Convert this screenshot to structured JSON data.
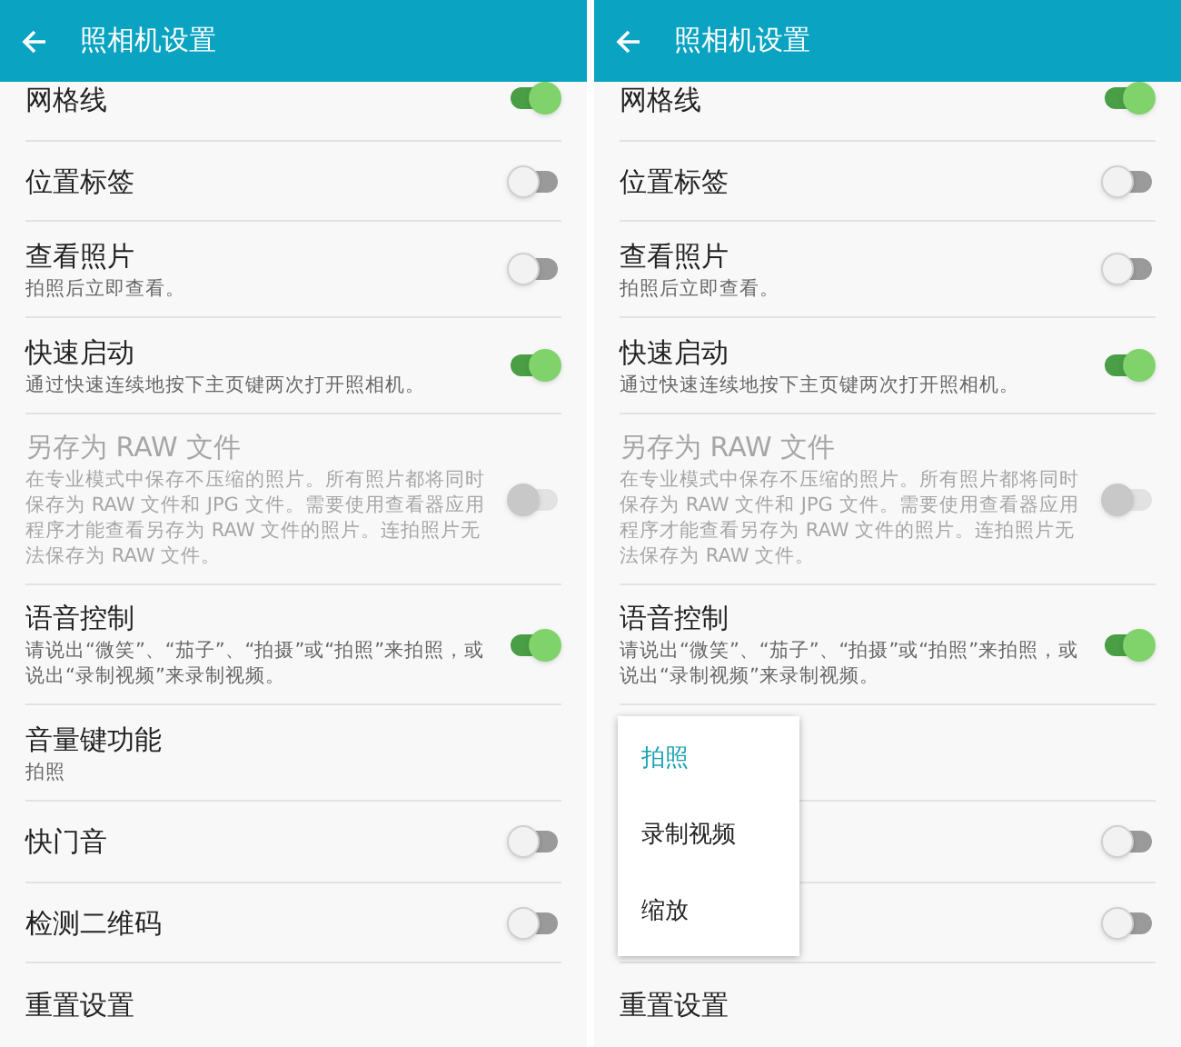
{
  "panels": [
    {
      "header": {
        "title": "照相机设置"
      },
      "settings": [
        {
          "kind": "toggle",
          "title": "网格线",
          "on": true,
          "disabled": false
        },
        {
          "kind": "toggle",
          "title": "位置标签",
          "on": false,
          "disabled": false
        },
        {
          "kind": "toggle",
          "title": "查看照片",
          "subtitle": "拍照后立即查看。",
          "on": false,
          "disabled": false
        },
        {
          "kind": "toggle",
          "title": "快速启动",
          "subtitle": "通过快速连续地按下主页键两次打开照相机。",
          "on": true,
          "disabled": false
        },
        {
          "kind": "toggle",
          "title": "另存为 RAW 文件",
          "subtitle": "在专业模式中保存不压缩的照片。所有照片都将同时保存为 RAW 文件和 JPG 文件。需要使用查看器应用程序才能查看另存为 RAW 文件的照片。连拍照片无法保存为 RAW 文件。",
          "on": false,
          "disabled": true
        },
        {
          "kind": "toggle",
          "title": "语音控制",
          "subtitle": "请说出“微笑”、“茄子”、“拍摄”或“拍照”来拍照，或说出“录制视频”来录制视频。",
          "on": true,
          "disabled": false
        },
        {
          "kind": "text",
          "title": "音量键功能",
          "subtitle": "拍照"
        },
        {
          "kind": "toggle",
          "title": "快门音",
          "on": false,
          "disabled": false
        },
        {
          "kind": "toggle",
          "title": "检测二维码",
          "on": false,
          "disabled": false
        },
        {
          "kind": "text",
          "title": "重置设置"
        }
      ]
    },
    {
      "header": {
        "title": "照相机设置"
      },
      "settings": [
        {
          "kind": "toggle",
          "title": "网格线",
          "on": true,
          "disabled": false
        },
        {
          "kind": "toggle",
          "title": "位置标签",
          "on": false,
          "disabled": false
        },
        {
          "kind": "toggle",
          "title": "查看照片",
          "subtitle": "拍照后立即查看。",
          "on": false,
          "disabled": false
        },
        {
          "kind": "toggle",
          "title": "快速启动",
          "subtitle": "通过快速连续地按下主页键两次打开照相机。",
          "on": true,
          "disabled": false
        },
        {
          "kind": "toggle",
          "title": "另存为 RAW 文件",
          "subtitle": "在专业模式中保存不压缩的照片。所有照片都将同时保存为 RAW 文件和 JPG 文件。需要使用查看器应用程序才能查看另存为 RAW 文件的照片。连拍照片无法保存为 RAW 文件。",
          "on": false,
          "disabled": true
        },
        {
          "kind": "toggle",
          "title": "语音控制",
          "subtitle": "请说出“微笑”、“茄子”、“拍摄”或“拍照”来拍照，或说出“录制视频”来录制视频。",
          "on": true,
          "disabled": false
        },
        {
          "kind": "text"
        },
        {
          "kind": "toggle",
          "on": false,
          "disabled": false
        },
        {
          "kind": "toggle",
          "on": false,
          "disabled": false
        },
        {
          "kind": "text",
          "title": "重置设置"
        }
      ],
      "menu": [
        {
          "label": "拍照",
          "selected": true
        },
        {
          "label": "录制视频",
          "selected": false
        },
        {
          "label": "缩放",
          "selected": false
        }
      ]
    }
  ]
}
